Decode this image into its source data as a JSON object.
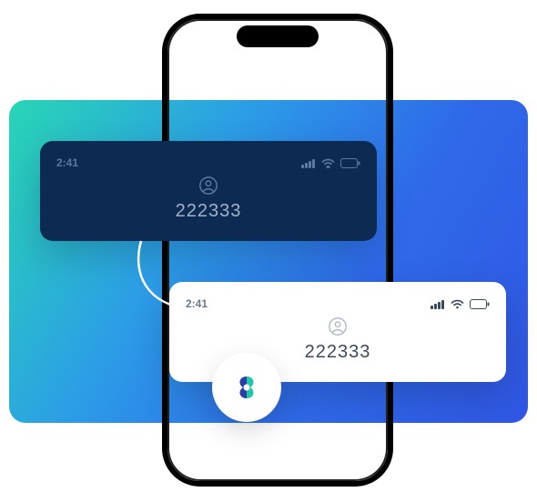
{
  "status_time": "2:41",
  "dark_card": {
    "code": "222333",
    "icon_name": "user-icon"
  },
  "light_card": {
    "code": "222333",
    "icon_name": "user-icon"
  },
  "logo_name": "brand-logo"
}
